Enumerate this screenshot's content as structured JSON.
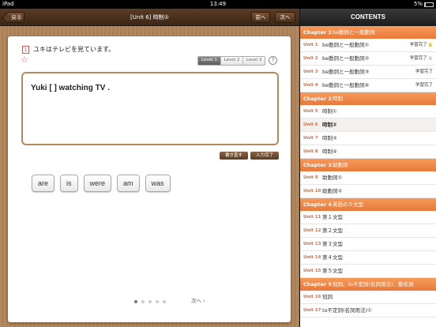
{
  "status": {
    "device": "iPad",
    "time": "13:49",
    "battery": "5%"
  },
  "nav": {
    "back": "戻る",
    "title": "[Unit 6] 時制②",
    "prev": "前へ",
    "next": "次へ"
  },
  "question": {
    "number": "1",
    "text": "ユキはテレビを見ています。",
    "levels": [
      "Level 1",
      "Level 2",
      "Level 3"
    ],
    "help": "?",
    "sentence": "Yuki [      ] watching TV .",
    "rewrite": "書き直す",
    "complete": "入力完了",
    "choices": [
      "are",
      "is",
      "were",
      "am",
      "was"
    ],
    "page_next": "次へ ›"
  },
  "contents": {
    "header": "CONTENTS",
    "chapters": [
      {
        "label": "Chapter 1",
        "title": "be動詞と一般動詞",
        "units": [
          {
            "num": "Unit  1",
            "title": "be動詞と一般動詞①",
            "status": "学習完了",
            "crown": "full"
          },
          {
            "num": "Unit  2",
            "title": "be動詞と一般動詞②",
            "status": "学習完了",
            "crown": "empty"
          },
          {
            "num": "Unit  3",
            "title": "be動詞と一般動詞③",
            "status": "学習完了",
            "crown": ""
          },
          {
            "num": "Unit  4",
            "title": "be動詞と一般動詞④",
            "status": "学習完了",
            "crown": ""
          }
        ]
      },
      {
        "label": "Chapter 2",
        "title": "時制",
        "units": [
          {
            "num": "Unit  5",
            "title": "時制①",
            "status": "",
            "crown": ""
          },
          {
            "num": "Unit  6",
            "title": "時制②",
            "status": "",
            "crown": "",
            "current": true
          },
          {
            "num": "Unit  7",
            "title": "時制③",
            "status": "",
            "crown": ""
          },
          {
            "num": "Unit  8",
            "title": "時制④",
            "status": "",
            "crown": ""
          }
        ]
      },
      {
        "label": "Chapter 3",
        "title": "助動詞",
        "units": [
          {
            "num": "Unit  9",
            "title": "助動詞①",
            "status": "",
            "crown": ""
          },
          {
            "num": "Unit 10",
            "title": "助動詞②",
            "status": "",
            "crown": ""
          }
        ]
      },
      {
        "label": "Chapter 4",
        "title": "英語の５文型",
        "units": [
          {
            "num": "Unit 11",
            "title": "第１文型",
            "status": "",
            "crown": ""
          },
          {
            "num": "Unit 12",
            "title": "第２文型",
            "status": "",
            "crown": ""
          },
          {
            "num": "Unit 13",
            "title": "第３文型",
            "status": "",
            "crown": ""
          },
          {
            "num": "Unit 14",
            "title": "第４文型",
            "status": "",
            "crown": ""
          },
          {
            "num": "Unit 15",
            "title": "第５文型",
            "status": "",
            "crown": ""
          }
        ]
      },
      {
        "label": "Chapter 5",
        "title": "冠詞、to不定詞(名詞用法)、動名詞",
        "units": [
          {
            "num": "Unit 16",
            "title": "冠詞",
            "status": "",
            "crown": ""
          },
          {
            "num": "Unit 17",
            "title": "to不定詞(名詞用法)①",
            "status": "",
            "crown": ""
          }
        ]
      }
    ]
  }
}
